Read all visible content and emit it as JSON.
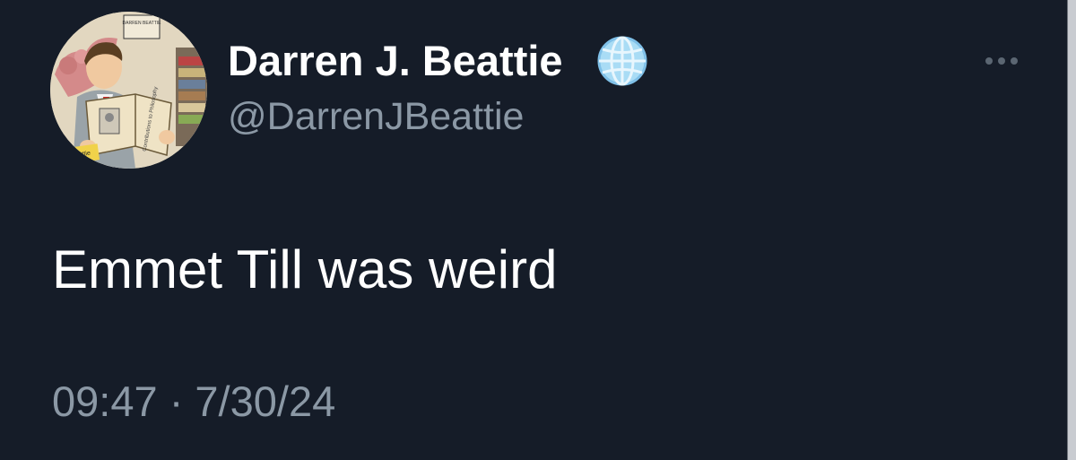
{
  "author": {
    "display_name": "Darren J. Beattie",
    "handle": "@DarrenJBeattie",
    "badge_icon": "globe-icon",
    "avatar_book_title": "Contributions to Philosophy",
    "avatar_sign_label": "Beattie",
    "avatar_poster_text": "DARREN BEATTIE"
  },
  "tweet": {
    "text": "Emmet Till was weird",
    "time": "09:47",
    "separator": "·",
    "date": "7/30/24"
  },
  "more_icon": "more-horizontal-icon",
  "colors": {
    "background": "#151c28",
    "primary_text": "#ffffff",
    "secondary_text": "#8b98a5",
    "globe_blue": "#7fc0e8"
  }
}
